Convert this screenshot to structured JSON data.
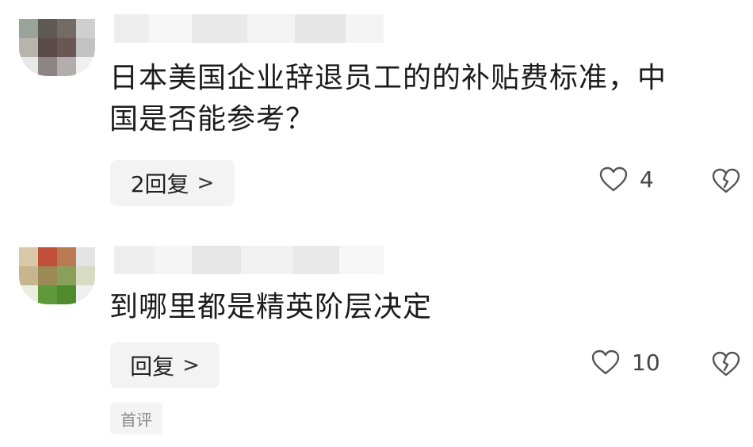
{
  "comments": [
    {
      "text_line1": "日本美国企业辞退员工的的补贴费标准，中",
      "text_line2": "国是否能参考？",
      "reply_label": "2回复",
      "reply_chevron": ">",
      "like_count": "4",
      "like_icon": "heart-outline-icon",
      "dislike_icon": "broken-heart-icon"
    },
    {
      "text_line1": "到哪里都是精英阶层决定",
      "reply_label": "回复",
      "reply_chevron": ">",
      "like_count": "10",
      "like_icon": "heart-outline-icon",
      "dislike_icon": "broken-heart-icon",
      "badge": "首评"
    }
  ],
  "colors": {
    "text": "#1c1c1c",
    "reply_bg": "#f3f3f3",
    "icon_stroke": "#555555",
    "badge_text": "#888888"
  }
}
